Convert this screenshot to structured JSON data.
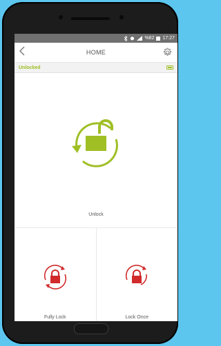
{
  "status_bar": {
    "icons": [
      "bluetooth-icon",
      "alarm-icon",
      "signal-icon",
      "battery-icon"
    ],
    "battery": "%82",
    "time": "17:27"
  },
  "header": {
    "title": "HOME",
    "back_icon": "chevron-left-icon",
    "settings_icon": "gear-icon"
  },
  "lock_state": {
    "status": "Unlocked",
    "battery_icon": "battery-full-icon"
  },
  "main_action": {
    "label": "Unlock",
    "icon": "unlock-cycle-icon",
    "color": "#9fbf25"
  },
  "actions": [
    {
      "label": "Fully Lock",
      "icon": "lock-cycle-icon",
      "color": "#d12b2b"
    },
    {
      "label": "Lock Once",
      "icon": "lock-cycle-icon",
      "color": "#d12b2b"
    }
  ]
}
